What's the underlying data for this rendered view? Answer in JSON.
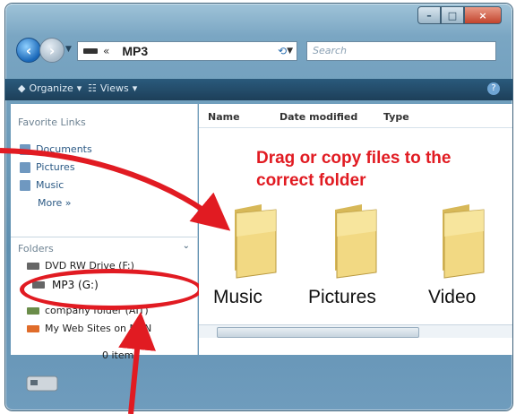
{
  "window": {
    "address_path": "MP3",
    "search_placeholder": "Search",
    "toolbar": {
      "organize": "Organize",
      "views": "Views"
    },
    "help": "?"
  },
  "sidebar": {
    "favorite_links_title": "Favorite Links",
    "favorites": [
      "Documents",
      "Pictures",
      "Music"
    ],
    "more": "More »",
    "folders_title": "Folders",
    "tree": [
      {
        "label": "DVD RW Drive (F:)"
      },
      {
        "label": "MP3 (G:)"
      },
      {
        "label": "company folder (AIT)"
      },
      {
        "label": "My Web Sites on MSN"
      }
    ],
    "items_count": "0 items"
  },
  "content": {
    "columns": [
      "Name",
      "Date modified",
      "Type"
    ],
    "instruction": "Drag or copy files to the correct folder",
    "folders": [
      "Music",
      "Pictures",
      "Video"
    ]
  }
}
